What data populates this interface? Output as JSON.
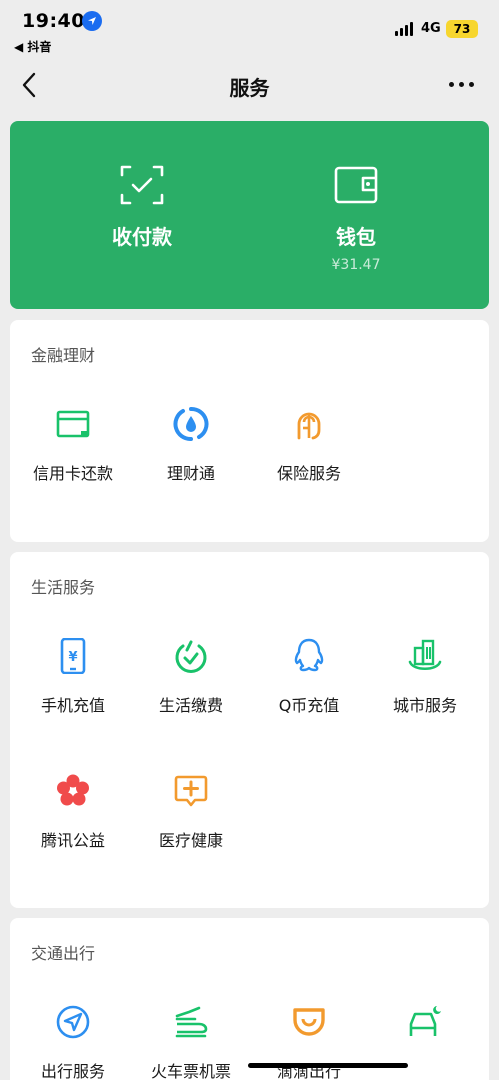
{
  "status_bar": {
    "time": "19:40",
    "back_app": "◀ 抖音",
    "network": "4G",
    "battery": "73"
  },
  "nav": {
    "title": "服务"
  },
  "pay_card": {
    "color": "#2aae67",
    "collect_pay_label": "收付款",
    "wallet_label": "钱包",
    "wallet_balance": "¥31.47"
  },
  "sections": [
    {
      "title": "金融理财",
      "items": [
        {
          "label": "信用卡还款",
          "icon": "credit-card-repay-icon"
        },
        {
          "label": "理财通",
          "icon": "wealth-management-icon"
        },
        {
          "label": "保险服务",
          "icon": "insurance-icon"
        }
      ]
    },
    {
      "title": "生活服务",
      "items": [
        {
          "label": "手机充值",
          "icon": "mobile-topup-icon"
        },
        {
          "label": "生活缴费",
          "icon": "utility-payment-icon"
        },
        {
          "label": "Q币充值",
          "icon": "qq-coin-icon"
        },
        {
          "label": "城市服务",
          "icon": "city-service-icon"
        },
        {
          "label": "腾讯公益",
          "icon": "tencent-charity-icon"
        },
        {
          "label": "医疗健康",
          "icon": "medical-health-icon"
        }
      ]
    },
    {
      "title": "交通出行",
      "items": [
        {
          "label": "出行服务",
          "icon": "travel-service-icon"
        },
        {
          "label": "火车票机票",
          "icon": "train-plane-ticket-icon"
        },
        {
          "label": "滴滴出行",
          "icon": "didi-icon"
        },
        {
          "label": "",
          "icon": "hotel-icon"
        }
      ]
    }
  ]
}
